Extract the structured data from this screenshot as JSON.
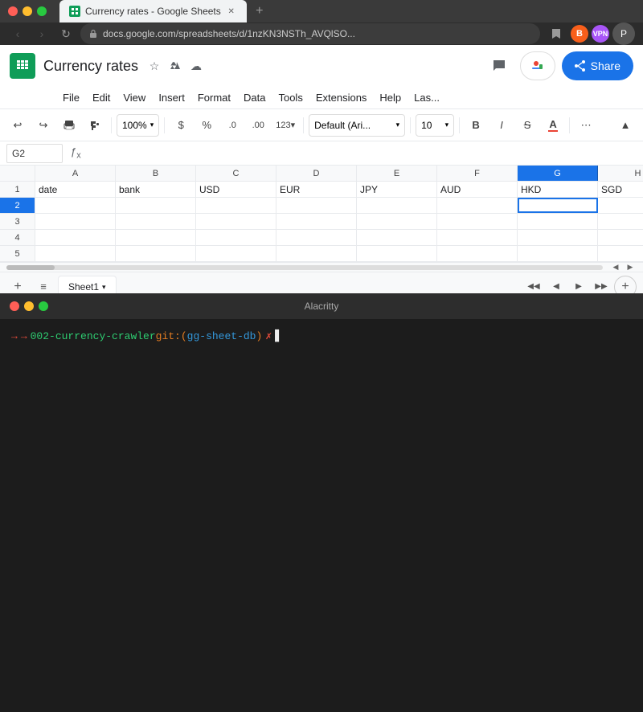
{
  "browser": {
    "tab_title": "Currency rates - Google Sheets",
    "url": "docs.google.com/spreadsheets/d/1nzKN3NSTh_AVQlSO...",
    "nav_back_disabled": true,
    "nav_forward_disabled": true
  },
  "sheets": {
    "title": "Currency rates",
    "file_menu": "File",
    "edit_menu": "Edit",
    "view_menu": "View",
    "insert_menu": "Insert",
    "format_menu": "Format",
    "data_menu": "Data",
    "tools_menu": "Tools",
    "extensions_menu": "Extensions",
    "help_menu": "Help",
    "last_edit": "Las...",
    "zoom": "100%",
    "font_name": "Default (Ari...",
    "font_size": "10",
    "share_label": "Share",
    "cell_ref": "G2",
    "sheet_tab": "Sheet1"
  },
  "grid": {
    "columns": [
      "A",
      "B",
      "C",
      "D",
      "E",
      "F",
      "G",
      "H"
    ],
    "rows": [
      {
        "row_num": "1",
        "cells": [
          "date",
          "bank",
          "USD",
          "EUR",
          "JPY",
          "AUD",
          "HKD",
          "SGD"
        ]
      },
      {
        "row_num": "2",
        "cells": [
          "",
          "",
          "",
          "",
          "",
          "",
          "",
          ""
        ]
      },
      {
        "row_num": "3",
        "cells": [
          "",
          "",
          "",
          "",
          "",
          "",
          "",
          ""
        ]
      },
      {
        "row_num": "4",
        "cells": [
          "",
          "",
          "",
          "",
          "",
          "",
          "",
          ""
        ]
      },
      {
        "row_num": "5",
        "cells": [
          "",
          "",
          "",
          "",
          "",
          "",
          "",
          ""
        ]
      }
    ],
    "active_cell": "G2",
    "active_col": "G",
    "active_row": "2"
  },
  "terminal": {
    "title": "Alacritty",
    "prompt_arrow": "→",
    "prompt_dir": "002-currency-crawler",
    "prompt_git": "git:(",
    "prompt_git_branch": "gg-sheet-db",
    "prompt_git_close": ")",
    "prompt_symbol": "✗"
  },
  "toolbar": {
    "undo_label": "↩",
    "redo_label": "↪",
    "print_label": "🖨",
    "paint_label": "🖌",
    "dollar_label": "$",
    "percent_label": "%",
    "decimal_decrease": ".0",
    "decimal_more": ".00",
    "number_format": "123",
    "bold_label": "B",
    "italic_label": "I",
    "strikethrough_label": "S",
    "text_color_label": "A",
    "more_label": "⋯",
    "collapse_label": "▲"
  }
}
